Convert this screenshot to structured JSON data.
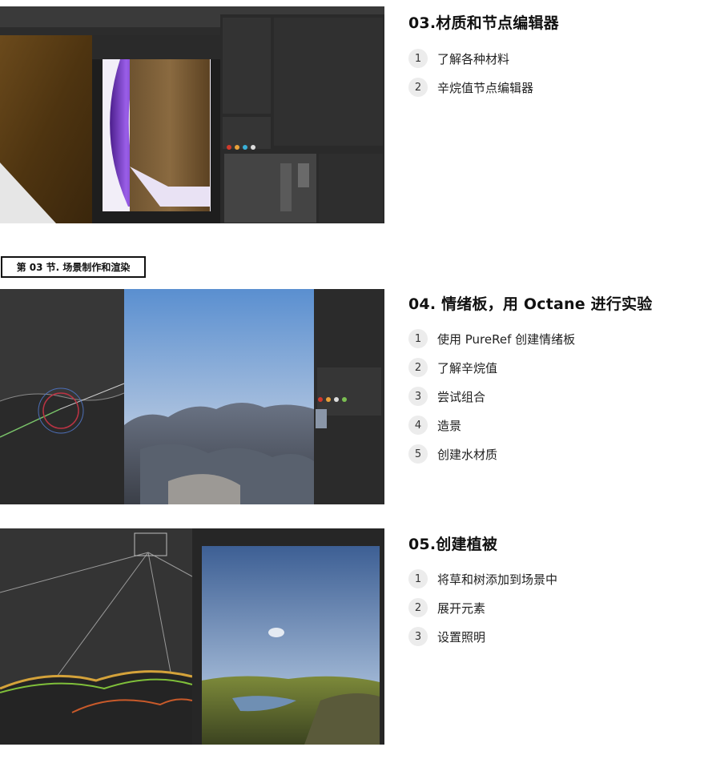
{
  "section_header": "第 03 节. 场景制作和渲染",
  "lessons": [
    {
      "title": "03.材质和节点编辑器",
      "topics": [
        {
          "num": "1",
          "text": "了解各种材料"
        },
        {
          "num": "2",
          "text": "辛烷值节点编辑器"
        }
      ]
    },
    {
      "title": "04. 情绪板，用 Octane 进行实验",
      "topics": [
        {
          "num": "1",
          "text": "使用 PureRef 创建情绪板"
        },
        {
          "num": "2",
          "text": "了解辛烷值"
        },
        {
          "num": "3",
          "text": "尝试组合"
        },
        {
          "num": "4",
          "text": "造景"
        },
        {
          "num": "5",
          "text": "创建水材质"
        }
      ]
    },
    {
      "title": "05.创建植被",
      "topics": [
        {
          "num": "1",
          "text": "将草和树添加到场景中"
        },
        {
          "num": "2",
          "text": "展开元素"
        },
        {
          "num": "3",
          "text": "设置照明"
        }
      ]
    }
  ]
}
